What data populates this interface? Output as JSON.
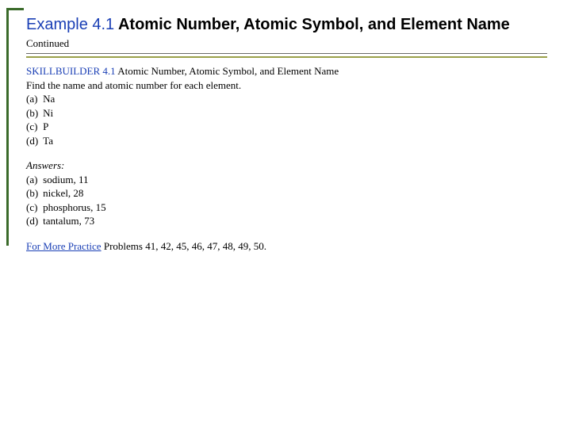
{
  "title": {
    "example_label": "Example 4.1",
    "rest": " Atomic Number, Atomic Symbol, and Element Name"
  },
  "continued": "Continued",
  "skillbuilder": {
    "label": "SKILLBUILDER 4.1",
    "rest": " Atomic Number, Atomic Symbol, and Element Name"
  },
  "instruction": "Find the name and atomic number for each element.",
  "questions": [
    {
      "letter": "(a)",
      "text": "Na"
    },
    {
      "letter": "(b)",
      "text": "Ni"
    },
    {
      "letter": "(c)",
      "text": "P"
    },
    {
      "letter": "(d)",
      "text": "Ta"
    }
  ],
  "answers_label": "Answers:",
  "answers": [
    {
      "letter": "(a)",
      "text": "sodium, 11"
    },
    {
      "letter": "(b)",
      "text": "nickel, 28"
    },
    {
      "letter": "(c)",
      "text": "phosphorus, 15"
    },
    {
      "letter": "(d)",
      "text": "tantalum, 73"
    }
  ],
  "more_practice": {
    "label": "For More Practice",
    "rest": " Problems 41, 42, 45, 46, 47, 48, 49, 50."
  }
}
